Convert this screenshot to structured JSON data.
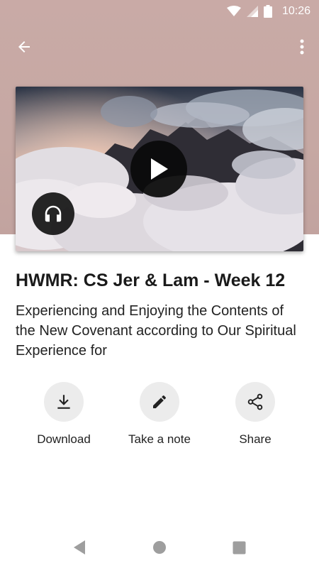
{
  "status_bar": {
    "time": "10:26"
  },
  "episode": {
    "title": "HWMR: CS Jer & Lam - Week 12",
    "description": "Experiencing and Enjoying the Contents of the New Covenant according to Our Spiritual Experience for"
  },
  "actions": {
    "download_label": "Download",
    "note_label": "Take a note",
    "share_label": "Share"
  },
  "icons": {
    "back": "arrow-left-icon",
    "more": "more-vert-icon",
    "play": "play-icon",
    "audio": "headphones-icon",
    "download": "download-icon",
    "note": "pencil-icon",
    "share": "share-icon"
  },
  "colors": {
    "header_background": "#c6a8a3",
    "action_circle": "#ececec",
    "nav_icon": "#9e9e9e"
  }
}
